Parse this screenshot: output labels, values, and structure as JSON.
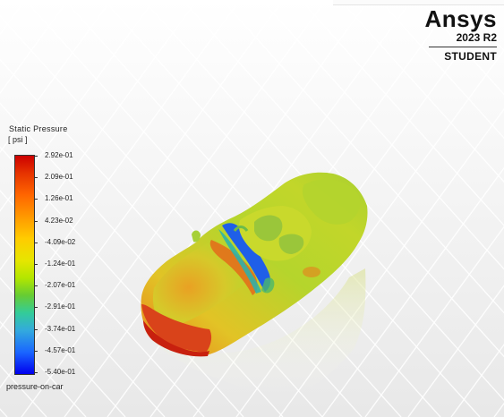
{
  "logo": {
    "brand": "Ansys",
    "version": "2023 R2",
    "edition": "STUDENT"
  },
  "colorbar": {
    "title": "Static Pressure",
    "unit": "[ psi ]",
    "labels": [
      "2.92e-01",
      "2.09e-01",
      "1.26e-01",
      "4.23e-02",
      "-4.09e-02",
      "-1.24e-01",
      "-2.07e-01",
      "-2.91e-01",
      "-3.74e-01",
      "-4.57e-01",
      "-5.40e-01"
    ],
    "footer": "pressure-on-car"
  },
  "scene": {
    "object": "car",
    "colors": {
      "high_pressure": "#e03a10",
      "mid_pressure": "#b8d92a",
      "low_pressure": "#1f5fe8"
    }
  }
}
